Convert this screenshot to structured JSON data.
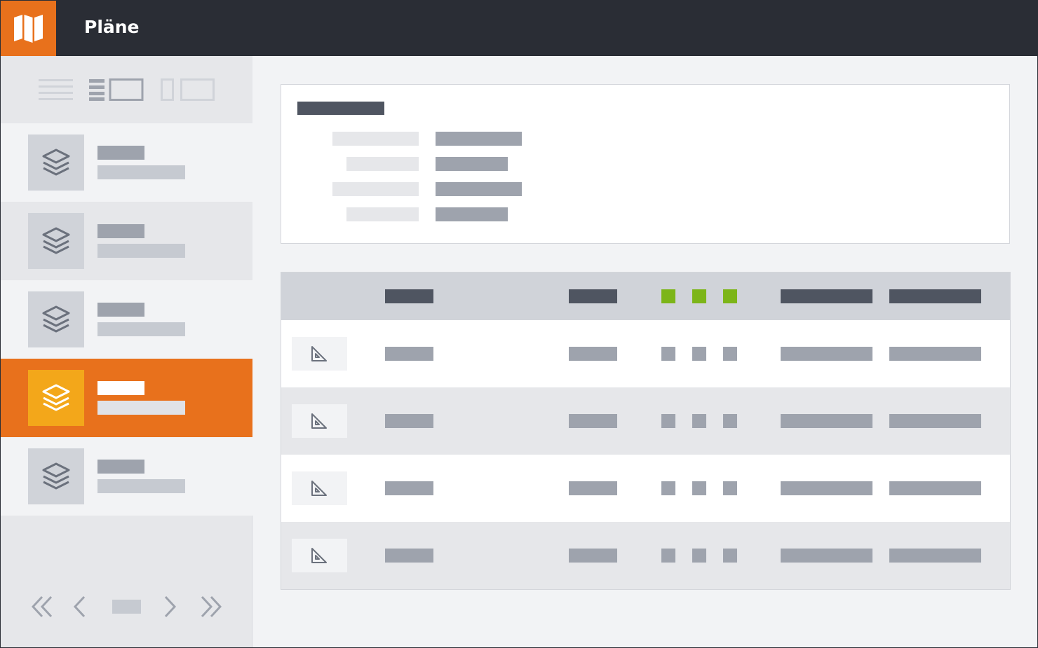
{
  "header": {
    "title": "Pläne",
    "logo_icon": "map-icon"
  },
  "sidebar": {
    "view_modes": [
      {
        "name": "list-view-icon",
        "selected": false
      },
      {
        "name": "split-view-icon",
        "selected": true
      },
      {
        "name": "detail-view-icon",
        "selected": false
      }
    ],
    "items": [
      {
        "icon": "layers-icon",
        "active": false
      },
      {
        "icon": "layers-icon",
        "active": false
      },
      {
        "icon": "layers-icon",
        "active": false
      },
      {
        "icon": "layers-icon",
        "active": true
      },
      {
        "icon": "layers-icon",
        "active": false
      }
    ],
    "pager_icons": [
      "double-chevron-left-icon",
      "chevron-left-icon",
      "chevron-right-icon",
      "double-chevron-right-icon"
    ]
  },
  "table": {
    "row_icon": "set-square-icon",
    "status_color_header": "#7cb518",
    "row_count": 4
  },
  "colors": {
    "accent": "#e8711c",
    "accent_secondary": "#f3a71a",
    "header_bg": "#2a2d35",
    "success": "#7cb518"
  }
}
